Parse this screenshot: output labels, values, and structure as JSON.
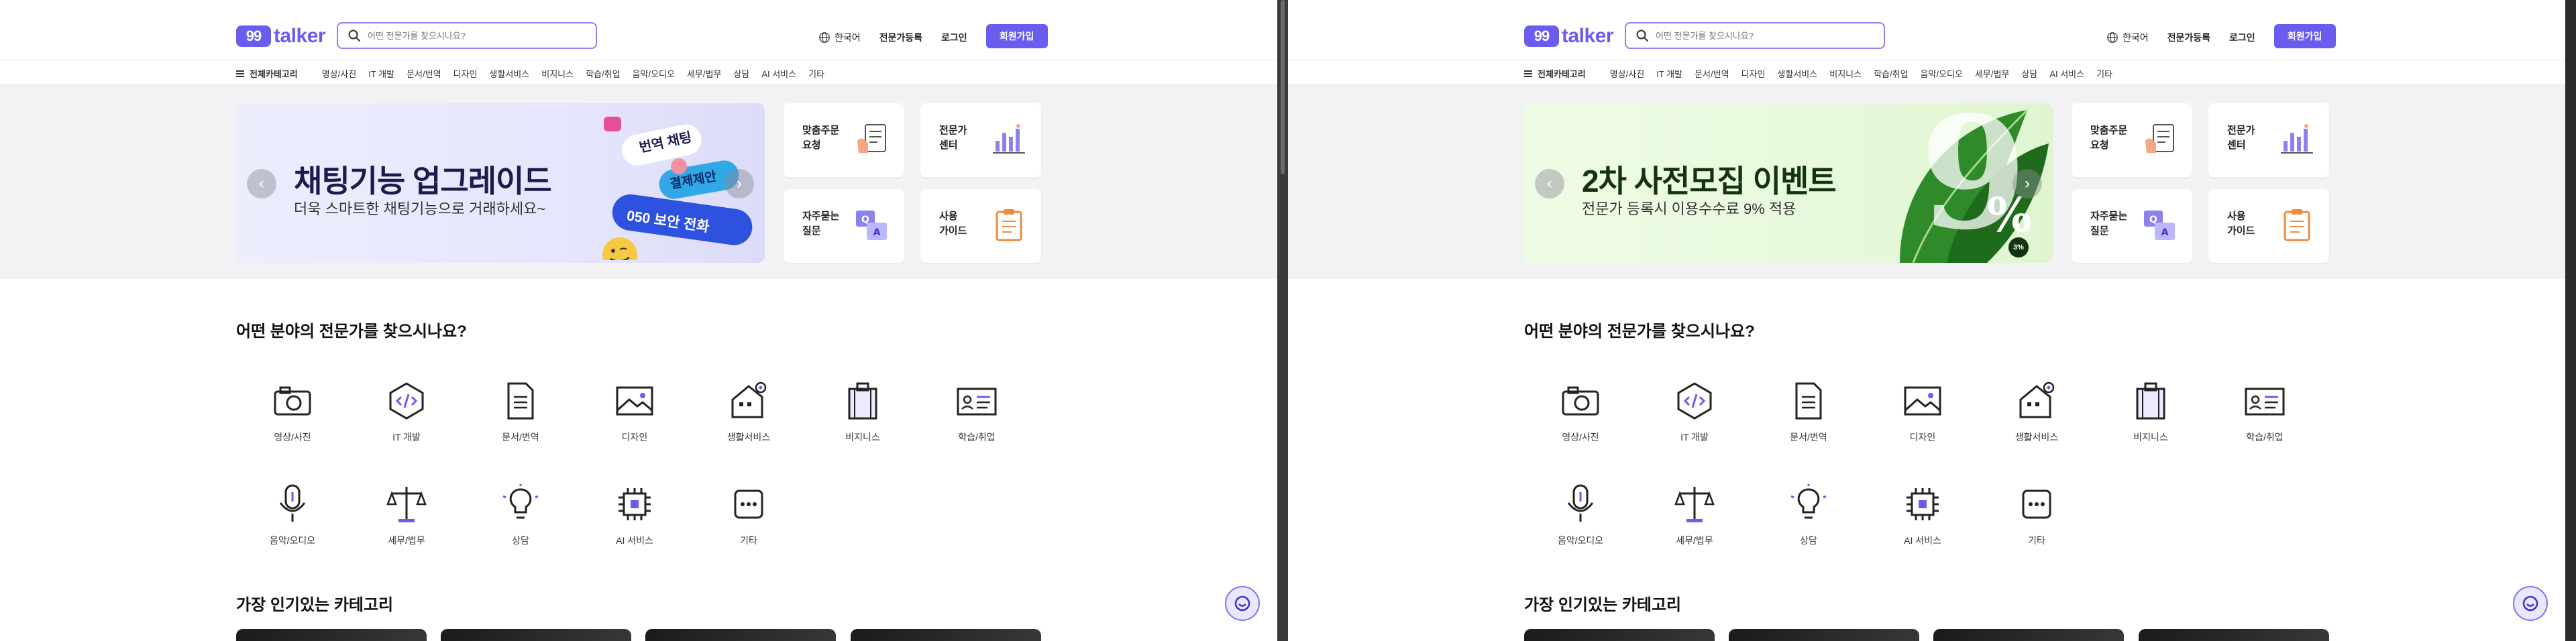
{
  "header": {
    "logo_badge": "99",
    "logo_text": "talker",
    "search_placeholder": "어떤 전문가를 찾으시나요?",
    "lang_label": "한국어",
    "expert_register": "전문가등록",
    "login": "로그인",
    "signup": "회원가입"
  },
  "catnav": {
    "all_label": "전체카테고리",
    "items": [
      "영상/사진",
      "IT 개발",
      "문서/번역",
      "디자인",
      "생활서비스",
      "비지니스",
      "학습/취업",
      "음악/오디오",
      "세무/법무",
      "상담",
      "AI 서비스",
      "기타"
    ]
  },
  "left_banner": {
    "title": "채팅기능 업그레이드",
    "subtitle": "더욱 스마트한 채팅기능으로 거래하세요~",
    "bubble1": "번역 채팅",
    "bubble2": "결제제안",
    "bubble3": "050 보안 전화",
    "accent": "#6b5cf0"
  },
  "right_banner": {
    "title": "2차 사전모집 이벤트",
    "subtitle": "전문가 등록시 이용수수료 9% 적용",
    "big_mark": "9",
    "percent": "%",
    "badge": "3%"
  },
  "side_cards": [
    {
      "label": "맞춤주문\n요청",
      "icon": "order-request-icon"
    },
    {
      "label": "전문가\n센터",
      "icon": "expert-center-icon"
    },
    {
      "label": "자주묻는\n질문",
      "icon": "faq-icon"
    },
    {
      "label": "사용\n가이드",
      "icon": "guide-icon"
    }
  ],
  "section_title": "어떤 분야의 전문가를 찾으시나요?",
  "categories": [
    {
      "label": "영상/사진",
      "icon": "camera-icon"
    },
    {
      "label": "IT 개발",
      "icon": "code-icon"
    },
    {
      "label": "문서/번역",
      "icon": "document-icon"
    },
    {
      "label": "디자인",
      "icon": "image-icon"
    },
    {
      "label": "생활서비스",
      "icon": "house-icon"
    },
    {
      "label": "비지니스",
      "icon": "briefcase-icon"
    },
    {
      "label": "학습/취업",
      "icon": "id-card-icon"
    },
    {
      "label": "음악/오디오",
      "icon": "microphone-icon"
    },
    {
      "label": "세무/법무",
      "icon": "scales-icon"
    },
    {
      "label": "상담",
      "icon": "lightbulb-icon"
    },
    {
      "label": "AI 서비스",
      "icon": "chip-icon"
    },
    {
      "label": "기타",
      "icon": "more-icon"
    }
  ],
  "popular_title": "가장 인기있는 카테고리"
}
